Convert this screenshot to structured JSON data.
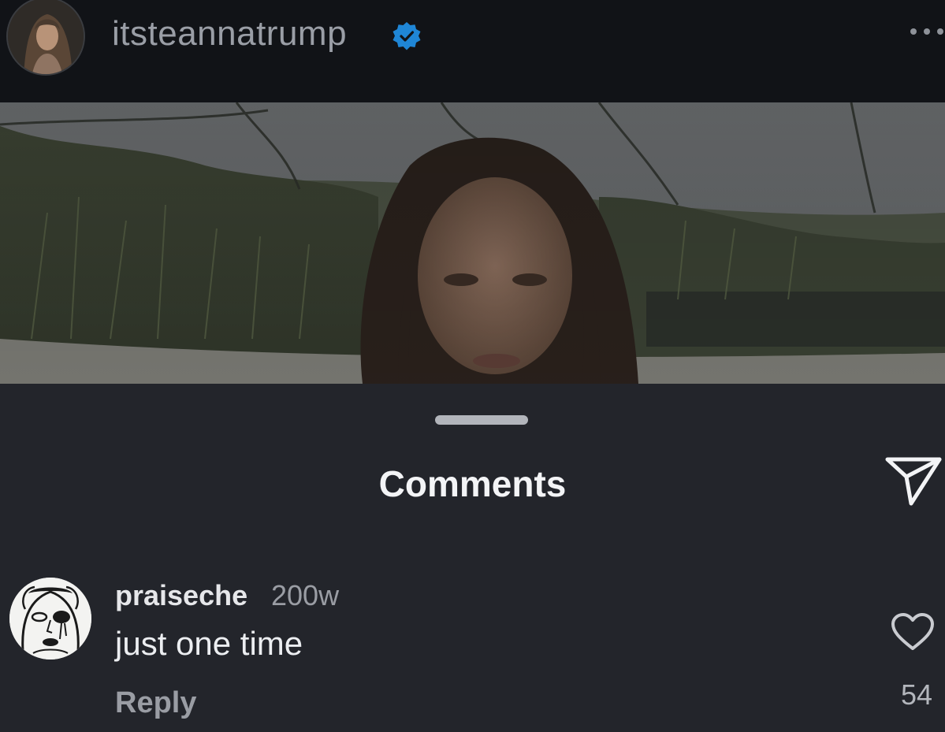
{
  "post": {
    "username": "itsteannatrump",
    "verified_icon": "verified-badge-icon",
    "more_icon": "more-options-icon"
  },
  "comments_sheet": {
    "title": "Comments",
    "share_icon": "send-icon"
  },
  "comment": {
    "author": "praiseche",
    "time": "200w",
    "text": "just one time",
    "reply_label": "Reply",
    "like_icon": "heart-icon",
    "like_count": "54"
  },
  "colors": {
    "header_bg": "#111317",
    "sheet_bg": "#23252b",
    "verified_blue": "#1f86d6",
    "text_primary": "#f3f4f6",
    "text_secondary": "#9a9da4"
  }
}
